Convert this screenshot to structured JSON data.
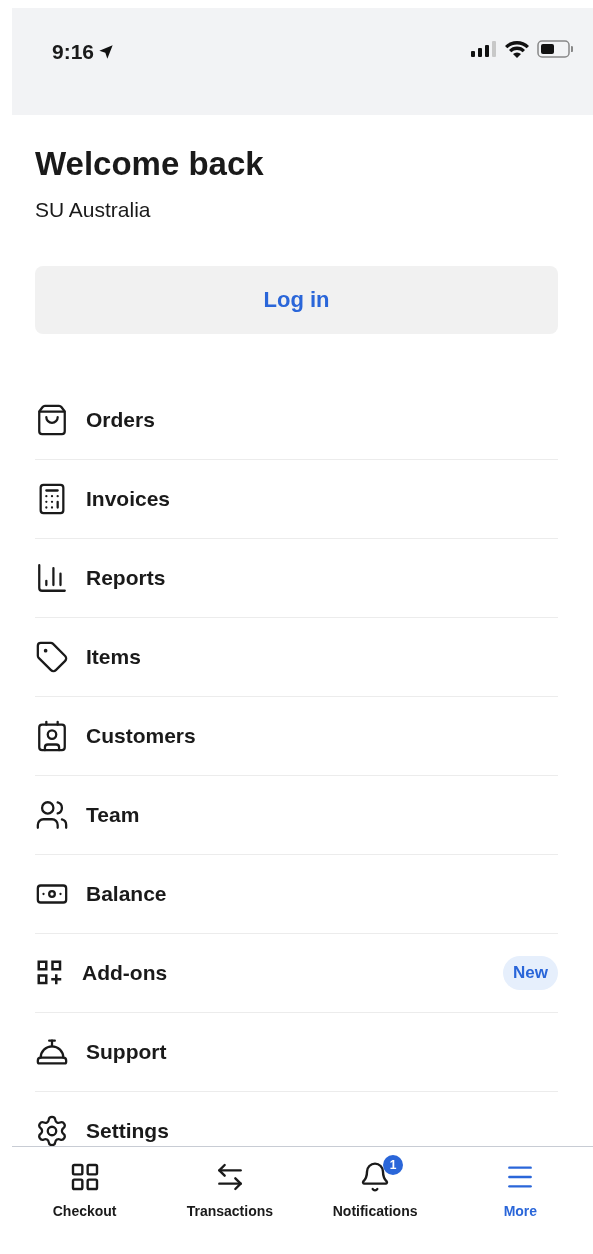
{
  "status_bar": {
    "time": "9:16"
  },
  "header": {
    "title": "Welcome back",
    "subtitle": "SU Australia"
  },
  "login_button": {
    "label": "Log in"
  },
  "menu": [
    {
      "label": "Orders"
    },
    {
      "label": "Invoices"
    },
    {
      "label": "Reports"
    },
    {
      "label": "Items"
    },
    {
      "label": "Customers"
    },
    {
      "label": "Team"
    },
    {
      "label": "Balance"
    },
    {
      "label": "Add-ons",
      "badge": "New"
    },
    {
      "label": "Support"
    },
    {
      "label": "Settings"
    }
  ],
  "tab_bar": [
    {
      "label": "Checkout",
      "selected": false
    },
    {
      "label": "Transactions",
      "selected": false
    },
    {
      "label": "Notifications",
      "selected": false,
      "badge": "1"
    },
    {
      "label": "More",
      "selected": true
    }
  ]
}
